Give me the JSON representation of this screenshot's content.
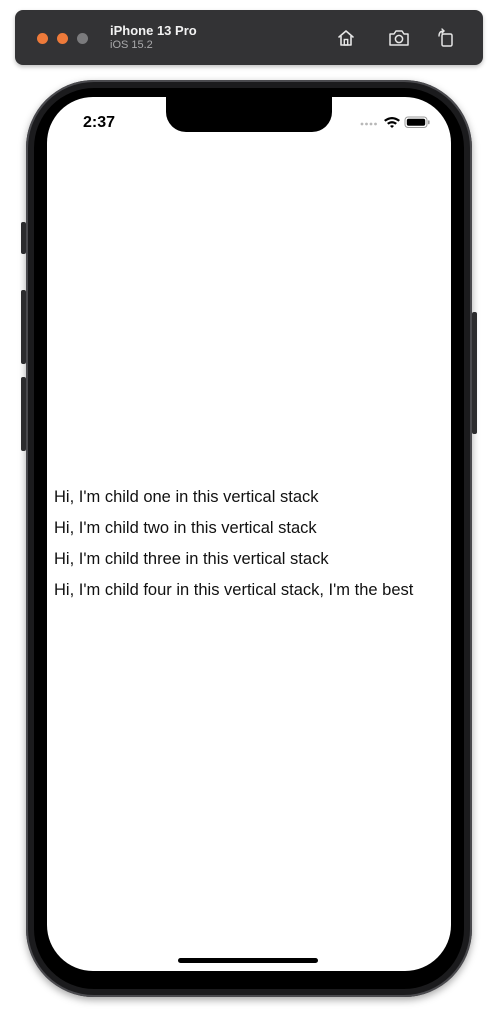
{
  "simulator": {
    "device_name": "iPhone 13 Pro",
    "os_version": "iOS 15.2",
    "buttons": {
      "home": "home-icon",
      "screenshot": "camera-icon",
      "rotate": "rotate-icon"
    },
    "window_controls": {
      "close_color": "#ee7a3a",
      "minimize_color": "#ee7a3a",
      "zoom_color": "#7b7b7d"
    }
  },
  "status_bar": {
    "time": "2:37",
    "signal": "signal-dots-icon",
    "wifi": "wifi-icon",
    "battery": "battery-icon"
  },
  "vstack": {
    "items": [
      "Hi, I'm child one in this vertical stack",
      "Hi, I'm child two in this vertical stack",
      "Hi, I'm child three in this vertical stack",
      "Hi, I'm child four in this vertical stack, I'm the best"
    ]
  }
}
